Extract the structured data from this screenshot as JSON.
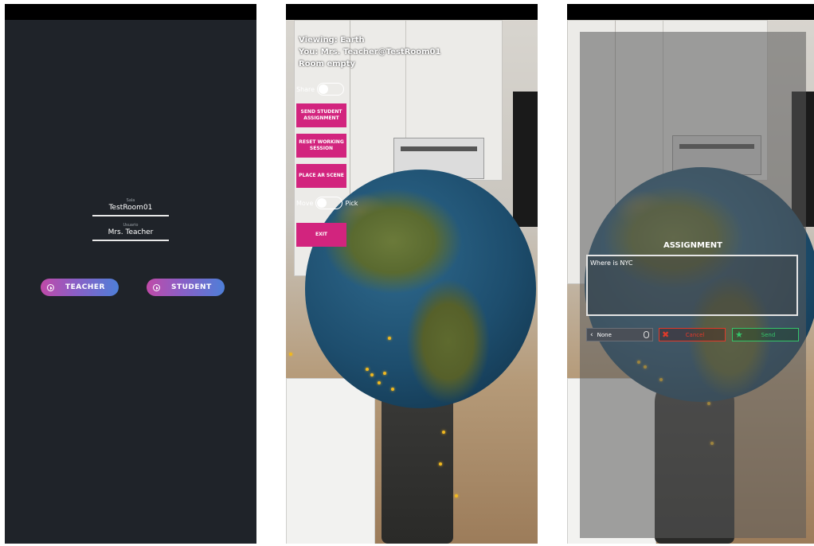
{
  "login": {
    "room_label": "Sala",
    "room_value": "TestRoom01",
    "user_label": "Usuario",
    "user_value": "Mrs. Teacher",
    "teacher_button": "TEACHER",
    "student_button": "STUDENT"
  },
  "ar_view": {
    "viewing": "Viewing: Earth",
    "you": "You: Mrs. Teacher@TestRoom01",
    "room_status": "Room empty",
    "share_label": "Share",
    "send_assignment": "SEND STUDENT ASSIGNMENT",
    "reset_session": "RESET WORKING SESSION",
    "place_scene": "PLACE AR SCENE",
    "move_label": "Move",
    "pick_label": "Pick",
    "exit": "EXIT"
  },
  "assignment": {
    "title": "ASSIGNMENT",
    "text": "Where is NYC",
    "select_value": "None",
    "cancel": "Cancel",
    "send": "Send"
  },
  "colors": {
    "accent_pink": "#d2247e",
    "cancel_red": "#e03a2a",
    "send_green": "#36c46a"
  }
}
